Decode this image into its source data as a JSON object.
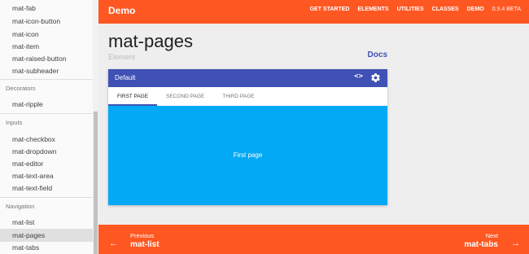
{
  "sidebar": {
    "items_top": [
      "mat-fab",
      "mat-icon-button",
      "mat-icon",
      "mat-item",
      "mat-raised-button",
      "mat-subheader"
    ],
    "decorators_header": "Decorators",
    "decorators_items": [
      "mat-ripple"
    ],
    "inputs_header": "Inputs",
    "inputs_items": [
      "mat-checkbox",
      "mat-dropdown",
      "mat-editor",
      "mat-text-area",
      "mat-text-field"
    ],
    "navigation_header": "Navigation",
    "navigation_items": [
      "mat-list",
      "mat-pages",
      "mat-tabs"
    ],
    "active_item": "mat-pages"
  },
  "header": {
    "brand": "Demo",
    "nav": [
      "GET STARTED",
      "ELEMENTS",
      "UTILITIES",
      "CLASSES",
      "DEMO"
    ],
    "version": "0.9.4 BETA"
  },
  "page": {
    "title": "mat-pages",
    "subtitle": "Element",
    "docs_link": "Docs"
  },
  "card": {
    "title": "Default",
    "code_icon": "<>",
    "tabs": [
      "FIRST PAGE",
      "SECOND PAGE",
      "THIRD PAGE"
    ],
    "active_tab": "FIRST PAGE",
    "panel_text": "First page"
  },
  "footer": {
    "prev_label": "Previous",
    "prev_title": "mat-list",
    "next_label": "Next",
    "next_title": "mat-tabs",
    "prev_arrow": "←",
    "next_arrow": "→"
  },
  "colors": {
    "accent": "#ff5722",
    "primary": "#3f51b5",
    "panel": "#03a9f4"
  }
}
